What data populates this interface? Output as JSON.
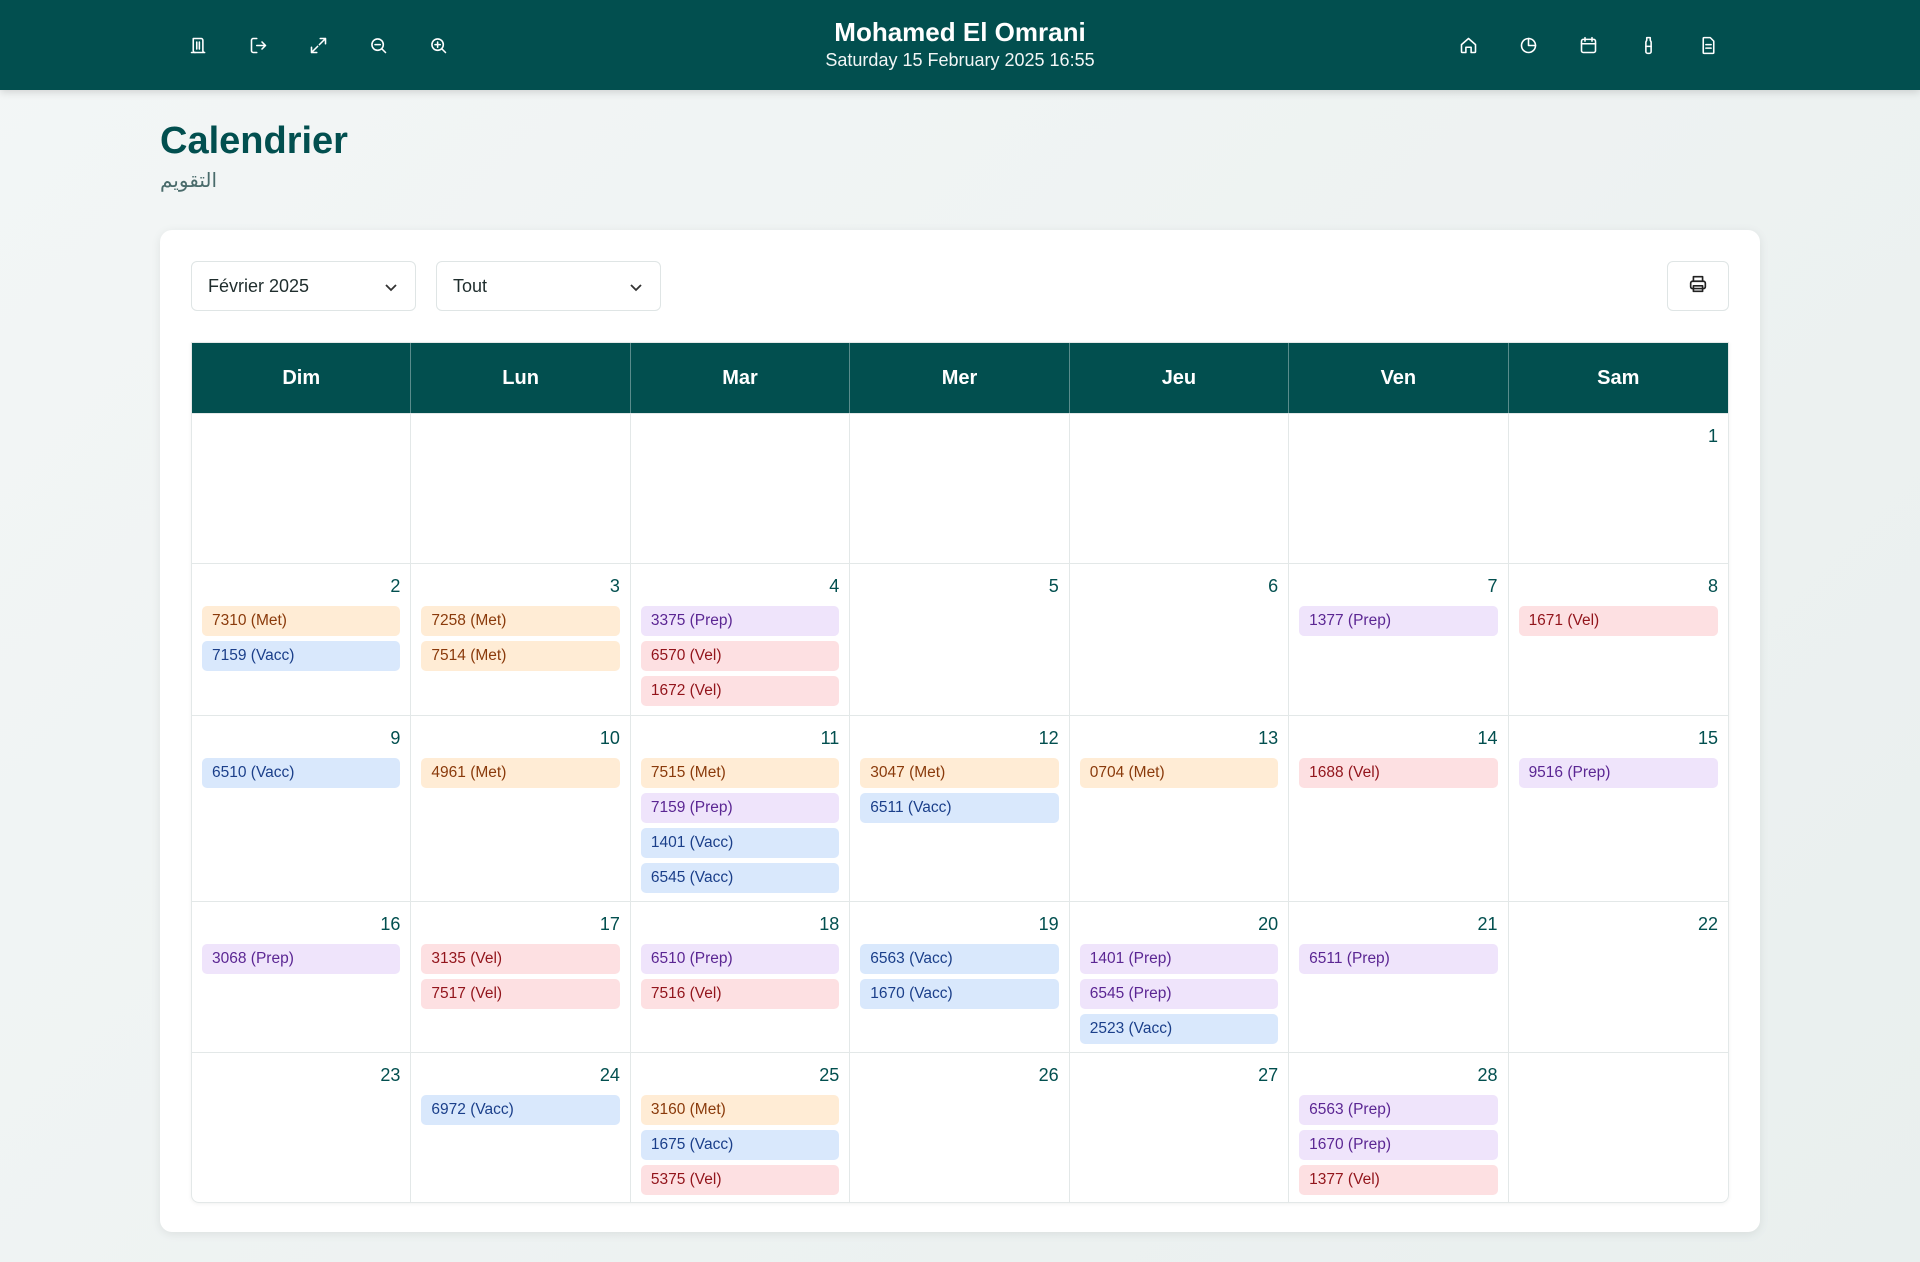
{
  "header": {
    "user_name": "Mohamed El Omrani",
    "datetime": "Saturday 15 February 2025 16:55",
    "left_icons": [
      "library-icon",
      "logout-icon",
      "fullscreen-icon",
      "zoom-out-icon",
      "zoom-in-icon"
    ],
    "right_icons": [
      "home-icon",
      "pie-chart-icon",
      "calendar-icon",
      "bottle-icon",
      "document-icon"
    ]
  },
  "page": {
    "title": "Calendrier",
    "subtitle": "التقويم"
  },
  "controls": {
    "month_select": "Février 2025",
    "filter_select": "Tout",
    "print_icon": "printer-icon"
  },
  "colors": {
    "primary": "#024f4f",
    "Met": "#ffecd5",
    "Vacc": "#d9e8fc",
    "Prep": "#efe4fb",
    "Vel": "#fde0e2"
  },
  "calendar": {
    "weekdays": [
      "Dim",
      "Lun",
      "Mar",
      "Mer",
      "Jeu",
      "Ven",
      "Sam"
    ],
    "weeks": [
      [
        {
          "day": "",
          "events": []
        },
        {
          "day": "",
          "events": []
        },
        {
          "day": "",
          "events": []
        },
        {
          "day": "",
          "events": []
        },
        {
          "day": "",
          "events": []
        },
        {
          "day": "",
          "events": []
        },
        {
          "day": "1",
          "events": []
        }
      ],
      [
        {
          "day": "2",
          "events": [
            {
              "label": "7310 (Met)",
              "type": "Met"
            },
            {
              "label": "7159 (Vacc)",
              "type": "Vacc"
            }
          ]
        },
        {
          "day": "3",
          "events": [
            {
              "label": "7258 (Met)",
              "type": "Met"
            },
            {
              "label": "7514 (Met)",
              "type": "Met"
            }
          ]
        },
        {
          "day": "4",
          "events": [
            {
              "label": "3375 (Prep)",
              "type": "Prep"
            },
            {
              "label": "6570 (Vel)",
              "type": "Vel"
            },
            {
              "label": "1672 (Vel)",
              "type": "Vel"
            }
          ]
        },
        {
          "day": "5",
          "events": []
        },
        {
          "day": "6",
          "events": []
        },
        {
          "day": "7",
          "events": [
            {
              "label": "1377 (Prep)",
              "type": "Prep"
            }
          ]
        },
        {
          "day": "8",
          "events": [
            {
              "label": "1671 (Vel)",
              "type": "Vel"
            }
          ]
        }
      ],
      [
        {
          "day": "9",
          "events": [
            {
              "label": "6510 (Vacc)",
              "type": "Vacc"
            }
          ]
        },
        {
          "day": "10",
          "events": [
            {
              "label": "4961 (Met)",
              "type": "Met"
            }
          ]
        },
        {
          "day": "11",
          "events": [
            {
              "label": "7515 (Met)",
              "type": "Met"
            },
            {
              "label": "7159 (Prep)",
              "type": "Prep"
            },
            {
              "label": "1401 (Vacc)",
              "type": "Vacc"
            },
            {
              "label": "6545 (Vacc)",
              "type": "Vacc"
            }
          ]
        },
        {
          "day": "12",
          "events": [
            {
              "label": "3047 (Met)",
              "type": "Met"
            },
            {
              "label": "6511 (Vacc)",
              "type": "Vacc"
            }
          ]
        },
        {
          "day": "13",
          "events": [
            {
              "label": "0704 (Met)",
              "type": "Met"
            }
          ]
        },
        {
          "day": "14",
          "events": [
            {
              "label": "1688 (Vel)",
              "type": "Vel"
            }
          ]
        },
        {
          "day": "15",
          "events": [
            {
              "label": "9516 (Prep)",
              "type": "Prep"
            }
          ]
        }
      ],
      [
        {
          "day": "16",
          "events": [
            {
              "label": "3068 (Prep)",
              "type": "Prep"
            }
          ]
        },
        {
          "day": "17",
          "events": [
            {
              "label": "3135 (Vel)",
              "type": "Vel"
            },
            {
              "label": "7517 (Vel)",
              "type": "Vel"
            }
          ]
        },
        {
          "day": "18",
          "events": [
            {
              "label": "6510 (Prep)",
              "type": "Prep"
            },
            {
              "label": "7516 (Vel)",
              "type": "Vel"
            }
          ]
        },
        {
          "day": "19",
          "events": [
            {
              "label": "6563 (Vacc)",
              "type": "Vacc"
            },
            {
              "label": "1670 (Vacc)",
              "type": "Vacc"
            }
          ]
        },
        {
          "day": "20",
          "events": [
            {
              "label": "1401 (Prep)",
              "type": "Prep"
            },
            {
              "label": "6545 (Prep)",
              "type": "Prep"
            },
            {
              "label": "2523 (Vacc)",
              "type": "Vacc"
            }
          ]
        },
        {
          "day": "21",
          "events": [
            {
              "label": "6511 (Prep)",
              "type": "Prep"
            }
          ]
        },
        {
          "day": "22",
          "events": []
        }
      ],
      [
        {
          "day": "23",
          "events": []
        },
        {
          "day": "24",
          "events": [
            {
              "label": "6972 (Vacc)",
              "type": "Vacc"
            }
          ]
        },
        {
          "day": "25",
          "events": [
            {
              "label": "3160 (Met)",
              "type": "Met"
            },
            {
              "label": "1675 (Vacc)",
              "type": "Vacc"
            },
            {
              "label": "5375 (Vel)",
              "type": "Vel"
            }
          ]
        },
        {
          "day": "26",
          "events": []
        },
        {
          "day": "27",
          "events": []
        },
        {
          "day": "28",
          "events": [
            {
              "label": "6563 (Prep)",
              "type": "Prep"
            },
            {
              "label": "1670 (Prep)",
              "type": "Prep"
            },
            {
              "label": "1377 (Vel)",
              "type": "Vel"
            }
          ]
        },
        {
          "day": "",
          "events": []
        }
      ]
    ]
  }
}
